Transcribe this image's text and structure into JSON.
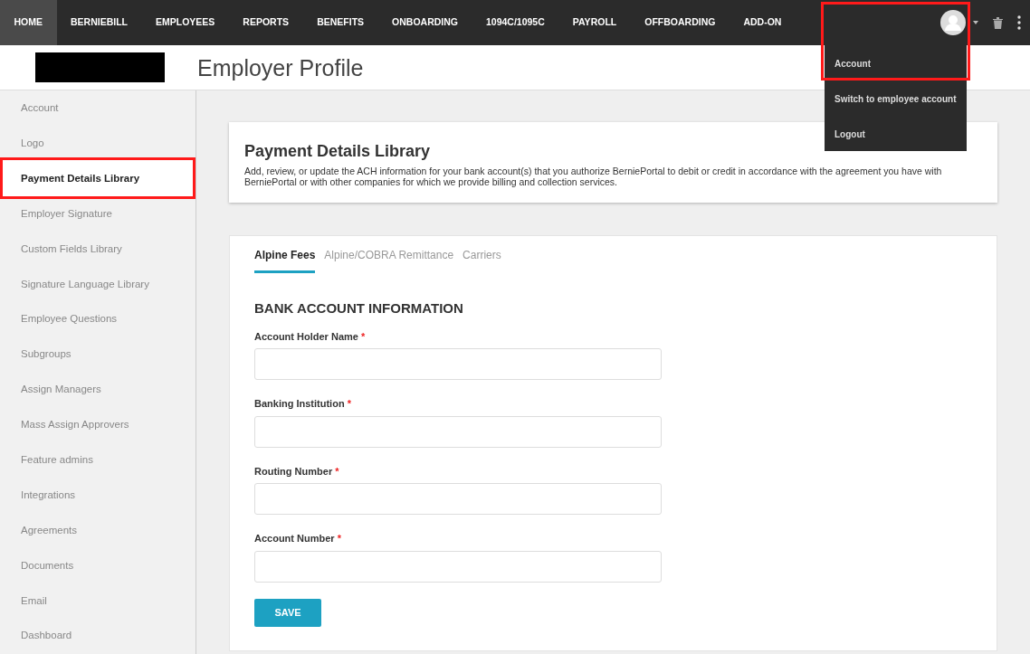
{
  "nav": {
    "items": [
      {
        "label": "HOME",
        "selected": true
      },
      {
        "label": "BERNIEBILL",
        "selected": false
      },
      {
        "label": "EMPLOYEES",
        "selected": false
      },
      {
        "label": "REPORTS",
        "selected": false
      },
      {
        "label": "BENEFITS",
        "selected": false
      },
      {
        "label": "ONBOARDING",
        "selected": false
      },
      {
        "label": "1094C/1095C",
        "selected": false
      },
      {
        "label": "PAYROLL",
        "selected": false
      },
      {
        "label": "OFFBOARDING",
        "selected": false
      },
      {
        "label": "ADD-ON",
        "selected": false
      }
    ],
    "user_menu": {
      "expanded": true,
      "items": [
        {
          "label": "Account",
          "highlighted": true
        },
        {
          "label": "Switch to employee account",
          "highlighted": false
        },
        {
          "label": "Logout",
          "highlighted": false
        }
      ]
    }
  },
  "header": {
    "title": "Employer Profile"
  },
  "sidebar": {
    "items": [
      {
        "label": "Account",
        "selected": false
      },
      {
        "label": "Logo",
        "selected": false
      },
      {
        "label": "Payment Details Library",
        "selected": true
      },
      {
        "label": "Employer Signature",
        "selected": false
      },
      {
        "label": "Custom Fields Library",
        "selected": false
      },
      {
        "label": "Signature Language Library",
        "selected": false
      },
      {
        "label": "Employee Questions",
        "selected": false
      },
      {
        "label": "Subgroups",
        "selected": false
      },
      {
        "label": "Assign Managers",
        "selected": false
      },
      {
        "label": "Mass Assign Approvers",
        "selected": false
      },
      {
        "label": "Feature admins",
        "selected": false
      },
      {
        "label": "Integrations",
        "selected": false
      },
      {
        "label": "Agreements",
        "selected": false
      },
      {
        "label": "Documents",
        "selected": false
      },
      {
        "label": "Email",
        "selected": false
      },
      {
        "label": "Dashboard",
        "selected": false
      }
    ]
  },
  "intro": {
    "title": "Payment Details Library",
    "description": "Add, review, or update the ACH information for your bank account(s) that you authorize BerniePortal to debit or credit in accordance with the agreement you have with BerniePortal or with other companies for which we provide billing and collection services."
  },
  "tabs": [
    {
      "label": "Alpine Fees",
      "selected": true
    },
    {
      "label": "Alpine/COBRA Remittance",
      "selected": false
    },
    {
      "label": "Carriers",
      "selected": false
    }
  ],
  "form": {
    "heading": "BANK ACCOUNT INFORMATION",
    "fields": [
      {
        "label": "Account Holder Name",
        "required": true,
        "required_mark": "*"
      },
      {
        "label": "Banking Institution",
        "required": true,
        "required_mark": "*"
      },
      {
        "label": "Routing Number",
        "required": true,
        "required_mark": "*"
      },
      {
        "label": "Account Number",
        "required": true,
        "required_mark": "*"
      }
    ],
    "button": "SAVE"
  }
}
